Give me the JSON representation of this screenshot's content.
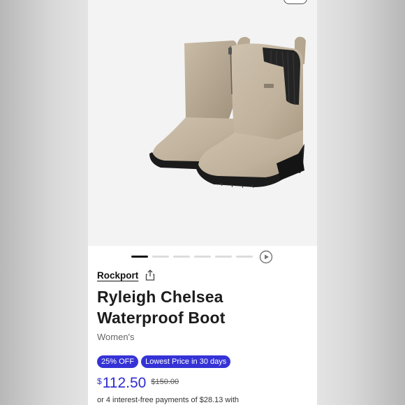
{
  "product": {
    "brand": "Rockport",
    "title_line1": "Ryleigh Chelsea",
    "title_line2": "Waterproof Boot",
    "gender": "Women's",
    "badges": [
      "25% OFF",
      "Lowest Price in 30 days"
    ],
    "currency": "$",
    "price": "112.50",
    "original_price": "$150.00",
    "installments": "or 4 interest-free payments of $28.13 with"
  },
  "carousel": {
    "total_slides": 6,
    "active_index": 0
  },
  "icons": {
    "share": "share-icon",
    "play": "play-icon"
  },
  "colors": {
    "accent": "#3533d6",
    "price": "#2f2ccf",
    "boot": "#c2b49f",
    "sole": "#1b1b1b"
  }
}
